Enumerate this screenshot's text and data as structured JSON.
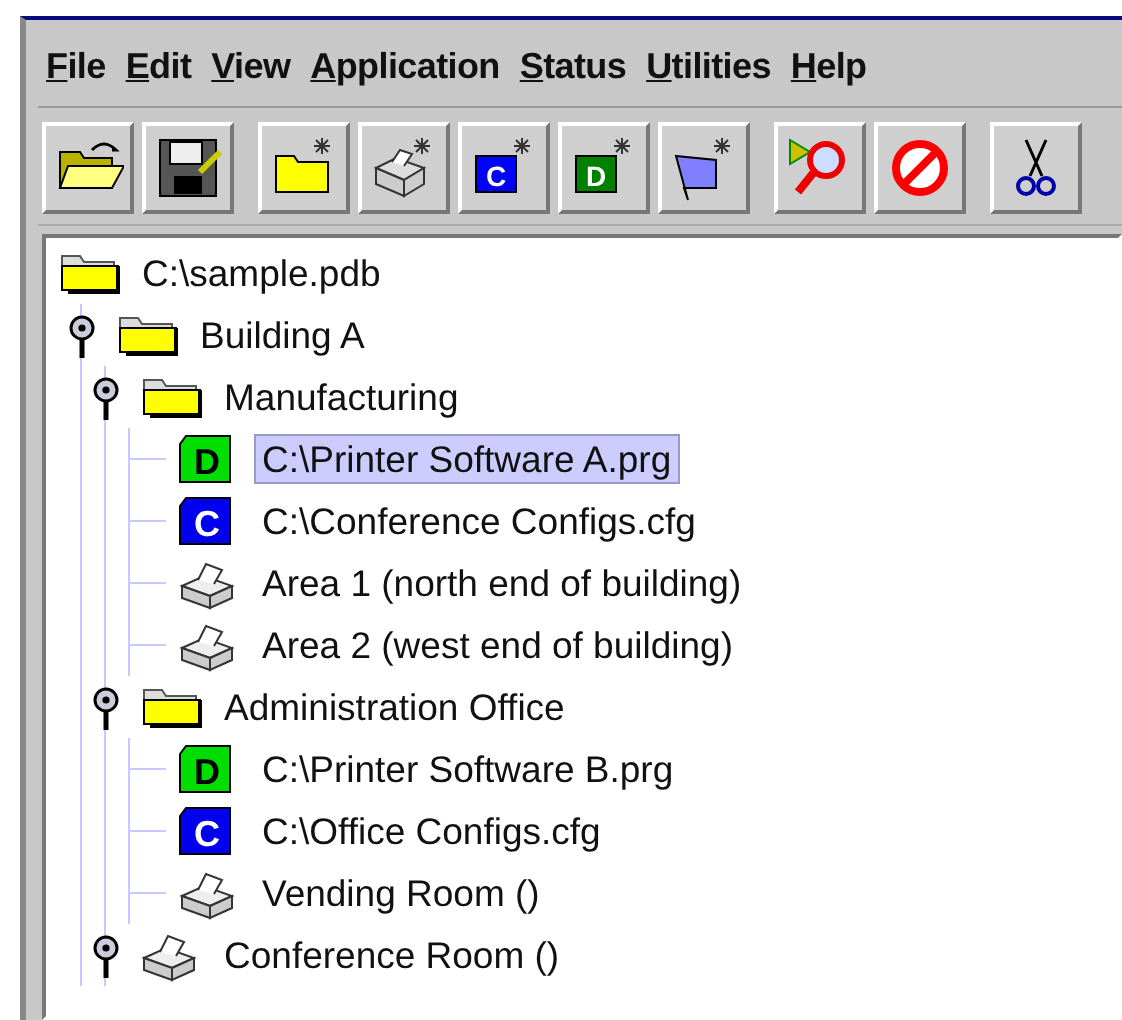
{
  "menu": [
    "File",
    "Edit",
    "View",
    "Application",
    "Status",
    "Utilities",
    "Help"
  ],
  "toolbar": [
    [
      {
        "kind": "open"
      },
      {
        "kind": "save"
      }
    ],
    [
      {
        "kind": "new-folder"
      },
      {
        "kind": "new-printer"
      },
      {
        "kind": "new-config",
        "glyph": "C"
      },
      {
        "kind": "new-data",
        "glyph": "D"
      },
      {
        "kind": "new-flag"
      }
    ],
    [
      {
        "kind": "find"
      },
      {
        "kind": "stop"
      }
    ],
    [
      {
        "kind": "cut"
      }
    ]
  ],
  "tree": {
    "kind": "folder",
    "label": "C:\\sample.pdb",
    "selected": false,
    "children": [
      {
        "kind": "folder",
        "label": "Building A",
        "selected": false,
        "expanded": true,
        "children": [
          {
            "kind": "folder",
            "label": "Manufacturing",
            "selected": false,
            "expanded": true,
            "children": [
              {
                "kind": "data",
                "glyph": "D",
                "label": "C:\\Printer Software A.prg",
                "selected": true
              },
              {
                "kind": "config",
                "glyph": "C",
                "label": "C:\\Conference Configs.cfg",
                "selected": false
              },
              {
                "kind": "printer",
                "label": "Area 1 (north end of building)",
                "selected": false
              },
              {
                "kind": "printer",
                "label": "Area 2 (west end of building)",
                "selected": false
              }
            ]
          },
          {
            "kind": "folder",
            "label": "Administration Office",
            "selected": false,
            "expanded": true,
            "children": [
              {
                "kind": "data",
                "glyph": "D",
                "label": "C:\\Printer Software B.prg",
                "selected": false
              },
              {
                "kind": "config",
                "glyph": "C",
                "label": "C:\\Office Configs.cfg",
                "selected": false
              },
              {
                "kind": "printer",
                "label": "Vending Room ()",
                "selected": false
              }
            ]
          },
          {
            "kind": "printer",
            "label": "Conference Room ()",
            "selected": false,
            "expanded": true
          }
        ]
      }
    ]
  }
}
